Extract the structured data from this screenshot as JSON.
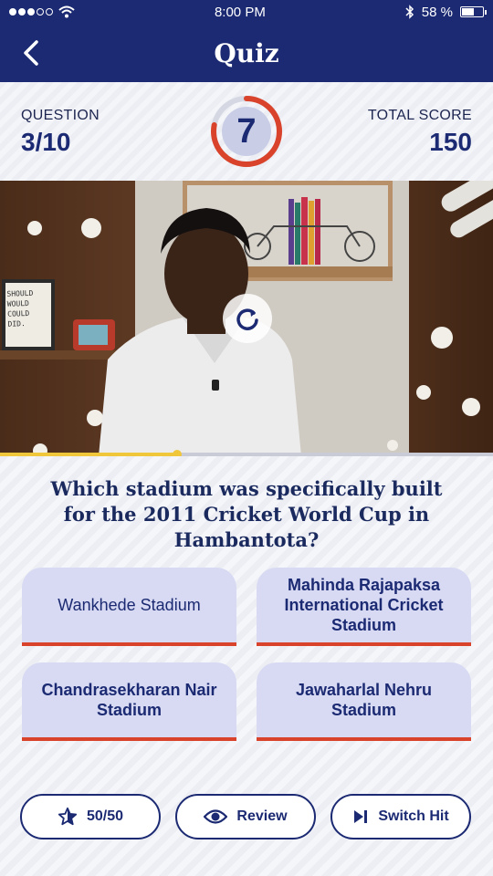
{
  "status": {
    "time": "8:00 PM",
    "battery": "58 %",
    "battery_level": 0.58,
    "signal_dots": 5,
    "signal_filled": 3
  },
  "header": {
    "title": "Quiz"
  },
  "stats": {
    "question_label": "QUESTION",
    "question_value": "3/10",
    "timer_value": "7",
    "timer_fraction_remaining": 0.78,
    "total_score_label": "TOTAL SCORE",
    "total_score_value": "150"
  },
  "video": {
    "progress": 0.36,
    "poster_text": "SHOULD WOULD COULD DID."
  },
  "question": {
    "text": "Which stadium was specifically built for the 2011 Cricket World Cup in Hambantota?"
  },
  "options": [
    "Wankhede Stadium",
    "Mahinda Rajapaksa International Cricket Stadium",
    "Chandrasekharan Nair Stadium",
    "Jawaharlal Nehru Stadium"
  ],
  "lifelines": {
    "fifty_fifty": "50/50",
    "review": "Review",
    "switch_hit": "Switch Hit"
  },
  "colors": {
    "brand_navy": "#1b2a72",
    "accent_red": "#d9432b",
    "option_bg": "#d7daf2",
    "progress_yellow": "#f0c63a"
  }
}
